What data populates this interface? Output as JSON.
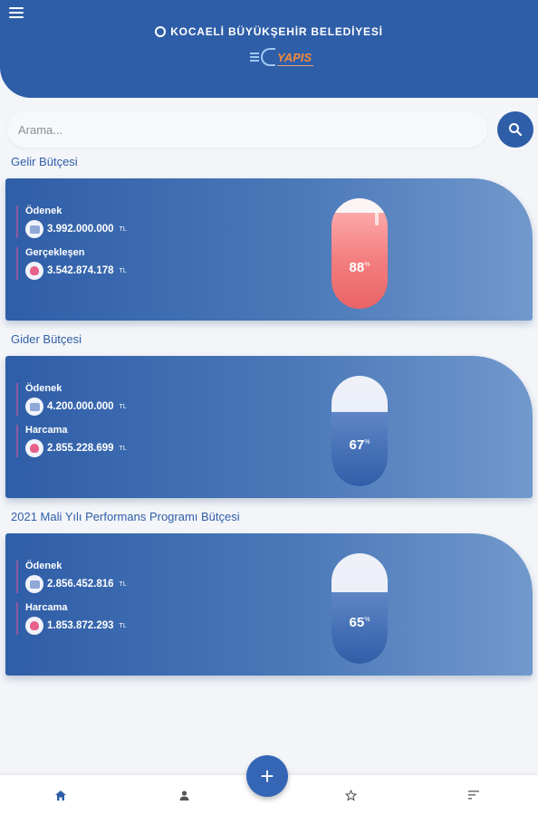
{
  "header": {
    "title": "KOCAELİ BÜYÜKŞEHİR BELEDİYESİ",
    "logo_text": "YAPIS",
    "menu_icon": "hamburger-menu-icon"
  },
  "search": {
    "placeholder": "Arama...",
    "button_icon": "search-icon"
  },
  "sections": [
    {
      "title": "Gelir Bütçesi",
      "rows": [
        {
          "label": "Ödenek",
          "value": "3.992.000.000",
          "unit": "TL",
          "icon": "coin-icon"
        },
        {
          "label": "Gerçekleşen",
          "value": "3.542.874.178",
          "unit": "TL",
          "icon": "heart-icon"
        }
      ],
      "percent": "88",
      "percent_symbol": "%",
      "fill_fraction": 0.88,
      "pill_color": "red"
    },
    {
      "title": "Gider Bütçesi",
      "rows": [
        {
          "label": "Ödenek",
          "value": "4.200.000.000",
          "unit": "TL",
          "icon": "coin-icon"
        },
        {
          "label": "Harcama",
          "value": "2.855.228.699",
          "unit": "TL",
          "icon": "heart-icon"
        }
      ],
      "percent": "67",
      "percent_symbol": "%",
      "fill_fraction": 0.67,
      "pill_color": "blue"
    },
    {
      "title": "2021 Mali Yılı Performans Programı Bütçesi",
      "rows": [
        {
          "label": "Ödenek",
          "value": "2.856.452.816",
          "unit": "TL",
          "icon": "coin-icon"
        },
        {
          "label": "Harcama",
          "value": "1.853.872.293",
          "unit": "TL",
          "icon": "heart-icon"
        }
      ],
      "percent": "65",
      "percent_symbol": "%",
      "fill_fraction": 0.65,
      "pill_color": "blue"
    }
  ],
  "colors": {
    "primary": "#2f5ea8",
    "accent_red": "#f47f80",
    "background": "#f3f5f9"
  },
  "bottom_nav": [
    "home-icon",
    "person-icon",
    "add-icon",
    "star-icon",
    "sort-icon"
  ]
}
